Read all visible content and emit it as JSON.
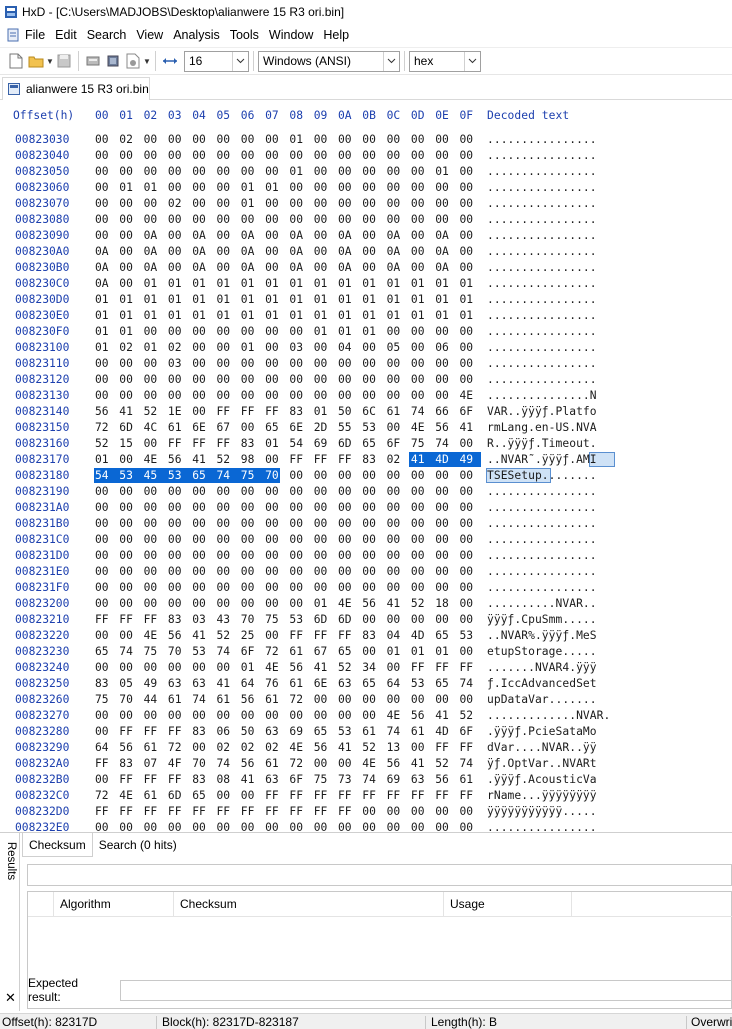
{
  "window": {
    "title": "HxD - [C:\\Users\\MADJOBS\\Desktop\\alianwere 15 R3 ori.bin]"
  },
  "menu": [
    "File",
    "Edit",
    "Search",
    "View",
    "Analysis",
    "Tools",
    "Window",
    "Help"
  ],
  "toolbar": {
    "bytes_per_row": "16",
    "charset": "Windows (ANSI)",
    "offset_base": "hex"
  },
  "tab": {
    "label": "alianwere 15 R3 ori.bin"
  },
  "hex_header": {
    "offset_label": "Offset(h)",
    "columns": [
      "00",
      "01",
      "02",
      "03",
      "04",
      "05",
      "06",
      "07",
      "08",
      "09",
      "0A",
      "0B",
      "0C",
      "0D",
      "0E",
      "0F"
    ],
    "decoded_label": "Decoded text"
  },
  "rows": [
    {
      "offset": "00823030",
      "bytes": [
        "00",
        "02",
        "00",
        "00",
        "00",
        "00",
        "00",
        "00",
        "01",
        "00",
        "00",
        "00",
        "00",
        "00",
        "00",
        "00"
      ],
      "text": "................"
    },
    {
      "offset": "00823040",
      "bytes": [
        "00",
        "00",
        "00",
        "00",
        "00",
        "00",
        "00",
        "00",
        "00",
        "00",
        "00",
        "00",
        "00",
        "00",
        "00",
        "00"
      ],
      "text": "................"
    },
    {
      "offset": "00823050",
      "bytes": [
        "00",
        "00",
        "00",
        "00",
        "00",
        "00",
        "00",
        "00",
        "01",
        "00",
        "00",
        "00",
        "00",
        "00",
        "01",
        "00"
      ],
      "text": "................"
    },
    {
      "offset": "00823060",
      "bytes": [
        "00",
        "01",
        "01",
        "00",
        "00",
        "00",
        "01",
        "01",
        "00",
        "00",
        "00",
        "00",
        "00",
        "00",
        "00",
        "00"
      ],
      "text": "................"
    },
    {
      "offset": "00823070",
      "bytes": [
        "00",
        "00",
        "00",
        "02",
        "00",
        "00",
        "01",
        "00",
        "00",
        "00",
        "00",
        "00",
        "00",
        "00",
        "00",
        "00"
      ],
      "text": "................"
    },
    {
      "offset": "00823080",
      "bytes": [
        "00",
        "00",
        "00",
        "00",
        "00",
        "00",
        "00",
        "00",
        "00",
        "00",
        "00",
        "00",
        "00",
        "00",
        "00",
        "00"
      ],
      "text": "................"
    },
    {
      "offset": "00823090",
      "bytes": [
        "00",
        "00",
        "0A",
        "00",
        "0A",
        "00",
        "0A",
        "00",
        "0A",
        "00",
        "0A",
        "00",
        "0A",
        "00",
        "0A",
        "00"
      ],
      "text": "................"
    },
    {
      "offset": "008230A0",
      "bytes": [
        "0A",
        "00",
        "0A",
        "00",
        "0A",
        "00",
        "0A",
        "00",
        "0A",
        "00",
        "0A",
        "00",
        "0A",
        "00",
        "0A",
        "00"
      ],
      "text": "................"
    },
    {
      "offset": "008230B0",
      "bytes": [
        "0A",
        "00",
        "0A",
        "00",
        "0A",
        "00",
        "0A",
        "00",
        "0A",
        "00",
        "0A",
        "00",
        "0A",
        "00",
        "0A",
        "00"
      ],
      "text": "................"
    },
    {
      "offset": "008230C0",
      "bytes": [
        "0A",
        "00",
        "01",
        "01",
        "01",
        "01",
        "01",
        "01",
        "01",
        "01",
        "01",
        "01",
        "01",
        "01",
        "01",
        "01"
      ],
      "text": "................"
    },
    {
      "offset": "008230D0",
      "bytes": [
        "01",
        "01",
        "01",
        "01",
        "01",
        "01",
        "01",
        "01",
        "01",
        "01",
        "01",
        "01",
        "01",
        "01",
        "01",
        "01"
      ],
      "text": "................"
    },
    {
      "offset": "008230E0",
      "bytes": [
        "01",
        "01",
        "01",
        "01",
        "01",
        "01",
        "01",
        "01",
        "01",
        "01",
        "01",
        "01",
        "01",
        "01",
        "01",
        "01"
      ],
      "text": "................"
    },
    {
      "offset": "008230F0",
      "bytes": [
        "01",
        "01",
        "00",
        "00",
        "00",
        "00",
        "00",
        "00",
        "00",
        "01",
        "01",
        "01",
        "00",
        "00",
        "00",
        "00"
      ],
      "text": "................"
    },
    {
      "offset": "00823100",
      "bytes": [
        "01",
        "02",
        "01",
        "02",
        "00",
        "00",
        "01",
        "00",
        "03",
        "00",
        "04",
        "00",
        "05",
        "00",
        "06",
        "00"
      ],
      "text": "................"
    },
    {
      "offset": "00823110",
      "bytes": [
        "00",
        "00",
        "00",
        "03",
        "00",
        "00",
        "00",
        "00",
        "00",
        "00",
        "00",
        "00",
        "00",
        "00",
        "00",
        "00"
      ],
      "text": "................"
    },
    {
      "offset": "00823120",
      "bytes": [
        "00",
        "00",
        "00",
        "00",
        "00",
        "00",
        "00",
        "00",
        "00",
        "00",
        "00",
        "00",
        "00",
        "00",
        "00",
        "00"
      ],
      "text": "................"
    },
    {
      "offset": "00823130",
      "bytes": [
        "00",
        "00",
        "00",
        "00",
        "00",
        "00",
        "00",
        "00",
        "00",
        "00",
        "00",
        "00",
        "00",
        "00",
        "00",
        "4E"
      ],
      "text": "...............N"
    },
    {
      "offset": "00823140",
      "bytes": [
        "56",
        "41",
        "52",
        "1E",
        "00",
        "FF",
        "FF",
        "FF",
        "83",
        "01",
        "50",
        "6C",
        "61",
        "74",
        "66",
        "6F"
      ],
      "text": "VAR..ÿÿÿƒ.Platfo"
    },
    {
      "offset": "00823150",
      "bytes": [
        "72",
        "6D",
        "4C",
        "61",
        "6E",
        "67",
        "00",
        "65",
        "6E",
        "2D",
        "55",
        "53",
        "00",
        "4E",
        "56",
        "41"
      ],
      "text": "rmLang.en-US.NVA"
    },
    {
      "offset": "00823160",
      "bytes": [
        "52",
        "15",
        "00",
        "FF",
        "FF",
        "FF",
        "83",
        "01",
        "54",
        "69",
        "6D",
        "65",
        "6F",
        "75",
        "74",
        "00"
      ],
      "text": "R..ÿÿÿƒ.Timeout."
    },
    {
      "offset": "00823170",
      "bytes": [
        "01",
        "00",
        "4E",
        "56",
        "41",
        "52",
        "98",
        "00",
        "FF",
        "FF",
        "FF",
        "83",
        "02",
        "41",
        "4D",
        "49"
      ],
      "text": "..NVAR˜.ÿÿÿƒ.AMI"
    },
    {
      "offset": "00823180",
      "bytes": [
        "54",
        "53",
        "45",
        "53",
        "65",
        "74",
        "75",
        "70",
        "00",
        "00",
        "00",
        "00",
        "00",
        "00",
        "00",
        "00"
      ],
      "text": "TSESetup........"
    },
    {
      "offset": "00823190",
      "bytes": [
        "00",
        "00",
        "00",
        "00",
        "00",
        "00",
        "00",
        "00",
        "00",
        "00",
        "00",
        "00",
        "00",
        "00",
        "00",
        "00"
      ],
      "text": "................"
    },
    {
      "offset": "008231A0",
      "bytes": [
        "00",
        "00",
        "00",
        "00",
        "00",
        "00",
        "00",
        "00",
        "00",
        "00",
        "00",
        "00",
        "00",
        "00",
        "00",
        "00"
      ],
      "text": "................"
    },
    {
      "offset": "008231B0",
      "bytes": [
        "00",
        "00",
        "00",
        "00",
        "00",
        "00",
        "00",
        "00",
        "00",
        "00",
        "00",
        "00",
        "00",
        "00",
        "00",
        "00"
      ],
      "text": "................"
    },
    {
      "offset": "008231C0",
      "bytes": [
        "00",
        "00",
        "00",
        "00",
        "00",
        "00",
        "00",
        "00",
        "00",
        "00",
        "00",
        "00",
        "00",
        "00",
        "00",
        "00"
      ],
      "text": "................"
    },
    {
      "offset": "008231D0",
      "bytes": [
        "00",
        "00",
        "00",
        "00",
        "00",
        "00",
        "00",
        "00",
        "00",
        "00",
        "00",
        "00",
        "00",
        "00",
        "00",
        "00"
      ],
      "text": "................"
    },
    {
      "offset": "008231E0",
      "bytes": [
        "00",
        "00",
        "00",
        "00",
        "00",
        "00",
        "00",
        "00",
        "00",
        "00",
        "00",
        "00",
        "00",
        "00",
        "00",
        "00"
      ],
      "text": "................"
    },
    {
      "offset": "008231F0",
      "bytes": [
        "00",
        "00",
        "00",
        "00",
        "00",
        "00",
        "00",
        "00",
        "00",
        "00",
        "00",
        "00",
        "00",
        "00",
        "00",
        "00"
      ],
      "text": "................"
    },
    {
      "offset": "00823200",
      "bytes": [
        "00",
        "00",
        "00",
        "00",
        "00",
        "00",
        "00",
        "00",
        "00",
        "01",
        "4E",
        "56",
        "41",
        "52",
        "18",
        "00"
      ],
      "text": "..........NVAR.."
    },
    {
      "offset": "00823210",
      "bytes": [
        "FF",
        "FF",
        "FF",
        "83",
        "03",
        "43",
        "70",
        "75",
        "53",
        "6D",
        "6D",
        "00",
        "00",
        "00",
        "00",
        "00"
      ],
      "text": "ÿÿÿƒ.CpuSmm....."
    },
    {
      "offset": "00823220",
      "bytes": [
        "00",
        "00",
        "4E",
        "56",
        "41",
        "52",
        "25",
        "00",
        "FF",
        "FF",
        "FF",
        "83",
        "04",
        "4D",
        "65",
        "53"
      ],
      "text": "..NVAR%.ÿÿÿƒ.MeS"
    },
    {
      "offset": "00823230",
      "bytes": [
        "65",
        "74",
        "75",
        "70",
        "53",
        "74",
        "6F",
        "72",
        "61",
        "67",
        "65",
        "00",
        "01",
        "01",
        "01",
        "00"
      ],
      "text": "etupStorage....."
    },
    {
      "offset": "00823240",
      "bytes": [
        "00",
        "00",
        "00",
        "00",
        "00",
        "00",
        "01",
        "4E",
        "56",
        "41",
        "52",
        "34",
        "00",
        "FF",
        "FF",
        "FF"
      ],
      "text": ".......NVAR4.ÿÿÿ"
    },
    {
      "offset": "00823250",
      "bytes": [
        "83",
        "05",
        "49",
        "63",
        "63",
        "41",
        "64",
        "76",
        "61",
        "6E",
        "63",
        "65",
        "64",
        "53",
        "65",
        "74"
      ],
      "text": "ƒ.IccAdvancedSet"
    },
    {
      "offset": "00823260",
      "bytes": [
        "75",
        "70",
        "44",
        "61",
        "74",
        "61",
        "56",
        "61",
        "72",
        "00",
        "00",
        "00",
        "00",
        "00",
        "00",
        "00"
      ],
      "text": "upDataVar......."
    },
    {
      "offset": "00823270",
      "bytes": [
        "00",
        "00",
        "00",
        "00",
        "00",
        "00",
        "00",
        "00",
        "00",
        "00",
        "00",
        "00",
        "4E",
        "56",
        "41",
        "52",
        "1D"
      ],
      "text": ".............NVAR."
    },
    {
      "offset": "00823280",
      "bytes": [
        "00",
        "FF",
        "FF",
        "FF",
        "83",
        "06",
        "50",
        "63",
        "69",
        "65",
        "53",
        "61",
        "74",
        "61",
        "4D",
        "6F"
      ],
      "text": ".ÿÿÿƒ.PcieSataMo"
    },
    {
      "offset": "00823290",
      "bytes": [
        "64",
        "56",
        "61",
        "72",
        "00",
        "02",
        "02",
        "02",
        "4E",
        "56",
        "41",
        "52",
        "13",
        "00",
        "FF",
        "FF"
      ],
      "text": "dVar....NVAR..ÿÿ"
    },
    {
      "offset": "008232A0",
      "bytes": [
        "FF",
        "83",
        "07",
        "4F",
        "70",
        "74",
        "56",
        "61",
        "72",
        "00",
        "00",
        "4E",
        "56",
        "41",
        "52",
        "74"
      ],
      "text": "ÿƒ.OptVar..NVARt"
    },
    {
      "offset": "008232B0",
      "bytes": [
        "00",
        "FF",
        "FF",
        "FF",
        "83",
        "08",
        "41",
        "63",
        "6F",
        "75",
        "73",
        "74",
        "69",
        "63",
        "56",
        "61"
      ],
      "text": ".ÿÿÿƒ.AcousticVa"
    },
    {
      "offset": "008232C0",
      "bytes": [
        "72",
        "4E",
        "61",
        "6D",
        "65",
        "00",
        "00",
        "FF",
        "FF",
        "FF",
        "FF",
        "FF",
        "FF",
        "FF",
        "FF",
        "FF"
      ],
      "text": "rName...ÿÿÿÿÿÿÿÿ"
    },
    {
      "offset": "008232D0",
      "bytes": [
        "FF",
        "FF",
        "FF",
        "FF",
        "FF",
        "FF",
        "FF",
        "FF",
        "FF",
        "FF",
        "FF",
        "00",
        "00",
        "00",
        "00",
        "00"
      ],
      "text": "ÿÿÿÿÿÿÿÿÿÿÿ....."
    },
    {
      "offset": "008232E0",
      "bytes": [
        "00",
        "00",
        "00",
        "00",
        "00",
        "00",
        "00",
        "00",
        "00",
        "00",
        "00",
        "00",
        "00",
        "00",
        "00",
        "00"
      ],
      "text": "................"
    }
  ],
  "results": {
    "panel_label": "Results",
    "tabs": [
      "Checksum",
      "Search (0 hits)"
    ],
    "columns": [
      "Algorithm",
      "Checksum",
      "Usage"
    ],
    "expected_label": "Expected result:"
  },
  "status": {
    "offset": "Offset(h): 82317D",
    "block": "Block(h): 82317D-823187",
    "length": "Length(h): B",
    "mode": "Overwrite"
  }
}
